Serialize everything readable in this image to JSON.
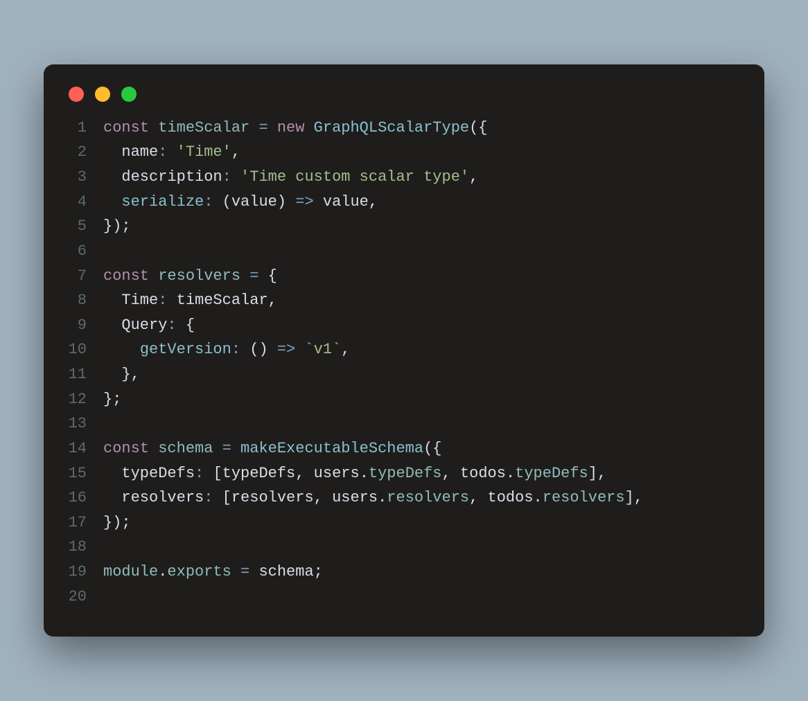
{
  "window": {
    "traffic_lights": [
      "red",
      "yellow",
      "green"
    ]
  },
  "colors": {
    "keyword": "#b48ead",
    "variable": "#8fbcbb",
    "operator": "#81a1c1",
    "call": "#88c0d0",
    "punctuation": "#d8dee9",
    "string": "#a3be8c",
    "gutter": "#5c6b6f",
    "background": "#1f1d1c",
    "page_background": "#a1b2bf"
  },
  "code": {
    "lines": [
      {
        "n": 1,
        "tokens": [
          {
            "cls": "kw",
            "t": "const"
          },
          {
            "cls": "ws",
            "t": " "
          },
          {
            "cls": "var",
            "t": "timeScalar"
          },
          {
            "cls": "ws",
            "t": " "
          },
          {
            "cls": "op",
            "t": "="
          },
          {
            "cls": "ws",
            "t": " "
          },
          {
            "cls": "kw",
            "t": "new"
          },
          {
            "cls": "ws",
            "t": " "
          },
          {
            "cls": "call",
            "t": "GraphQLScalarType"
          },
          {
            "cls": "pun",
            "t": "({"
          }
        ]
      },
      {
        "n": 2,
        "tokens": [
          {
            "cls": "ws",
            "t": "  "
          },
          {
            "cls": "prop",
            "t": "name"
          },
          {
            "cls": "op",
            "t": ":"
          },
          {
            "cls": "ws",
            "t": " "
          },
          {
            "cls": "str",
            "t": "'Time'"
          },
          {
            "cls": "pun",
            "t": ","
          }
        ]
      },
      {
        "n": 3,
        "tokens": [
          {
            "cls": "ws",
            "t": "  "
          },
          {
            "cls": "prop",
            "t": "description"
          },
          {
            "cls": "op",
            "t": ":"
          },
          {
            "cls": "ws",
            "t": " "
          },
          {
            "cls": "str",
            "t": "'Time custom scalar type'"
          },
          {
            "cls": "pun",
            "t": ","
          }
        ]
      },
      {
        "n": 4,
        "tokens": [
          {
            "cls": "ws",
            "t": "  "
          },
          {
            "cls": "call",
            "t": "serialize"
          },
          {
            "cls": "op",
            "t": ":"
          },
          {
            "cls": "ws",
            "t": " "
          },
          {
            "cls": "pun",
            "t": "("
          },
          {
            "cls": "param",
            "t": "value"
          },
          {
            "cls": "pun",
            "t": ")"
          },
          {
            "cls": "ws",
            "t": " "
          },
          {
            "cls": "op",
            "t": "=>"
          },
          {
            "cls": "ws",
            "t": " "
          },
          {
            "cls": "prop",
            "t": "value"
          },
          {
            "cls": "pun",
            "t": ","
          }
        ]
      },
      {
        "n": 5,
        "tokens": [
          {
            "cls": "pun",
            "t": "});"
          }
        ]
      },
      {
        "n": 6,
        "tokens": []
      },
      {
        "n": 7,
        "tokens": [
          {
            "cls": "kw",
            "t": "const"
          },
          {
            "cls": "ws",
            "t": " "
          },
          {
            "cls": "var",
            "t": "resolvers"
          },
          {
            "cls": "ws",
            "t": " "
          },
          {
            "cls": "op",
            "t": "="
          },
          {
            "cls": "ws",
            "t": " "
          },
          {
            "cls": "pun",
            "t": "{"
          }
        ]
      },
      {
        "n": 8,
        "tokens": [
          {
            "cls": "ws",
            "t": "  "
          },
          {
            "cls": "prop",
            "t": "Time"
          },
          {
            "cls": "op",
            "t": ":"
          },
          {
            "cls": "ws",
            "t": " "
          },
          {
            "cls": "prop",
            "t": "timeScalar"
          },
          {
            "cls": "pun",
            "t": ","
          }
        ]
      },
      {
        "n": 9,
        "tokens": [
          {
            "cls": "ws",
            "t": "  "
          },
          {
            "cls": "prop",
            "t": "Query"
          },
          {
            "cls": "op",
            "t": ":"
          },
          {
            "cls": "ws",
            "t": " "
          },
          {
            "cls": "pun",
            "t": "{"
          }
        ]
      },
      {
        "n": 10,
        "tokens": [
          {
            "cls": "ws",
            "t": "    "
          },
          {
            "cls": "call",
            "t": "getVersion"
          },
          {
            "cls": "op",
            "t": ":"
          },
          {
            "cls": "ws",
            "t": " "
          },
          {
            "cls": "pun",
            "t": "()"
          },
          {
            "cls": "ws",
            "t": " "
          },
          {
            "cls": "op",
            "t": "=>"
          },
          {
            "cls": "ws",
            "t": " "
          },
          {
            "cls": "tpl",
            "t": "`v1`"
          },
          {
            "cls": "pun",
            "t": ","
          }
        ]
      },
      {
        "n": 11,
        "tokens": [
          {
            "cls": "ws",
            "t": "  "
          },
          {
            "cls": "pun",
            "t": "},"
          }
        ]
      },
      {
        "n": 12,
        "tokens": [
          {
            "cls": "pun",
            "t": "};"
          }
        ]
      },
      {
        "n": 13,
        "tokens": []
      },
      {
        "n": 14,
        "tokens": [
          {
            "cls": "kw",
            "t": "const"
          },
          {
            "cls": "ws",
            "t": " "
          },
          {
            "cls": "var",
            "t": "schema"
          },
          {
            "cls": "ws",
            "t": " "
          },
          {
            "cls": "op",
            "t": "="
          },
          {
            "cls": "ws",
            "t": " "
          },
          {
            "cls": "call",
            "t": "makeExecutableSchema"
          },
          {
            "cls": "pun",
            "t": "({"
          }
        ]
      },
      {
        "n": 15,
        "tokens": [
          {
            "cls": "ws",
            "t": "  "
          },
          {
            "cls": "prop",
            "t": "typeDefs"
          },
          {
            "cls": "op",
            "t": ":"
          },
          {
            "cls": "ws",
            "t": " "
          },
          {
            "cls": "pun",
            "t": "["
          },
          {
            "cls": "prop",
            "t": "typeDefs"
          },
          {
            "cls": "pun",
            "t": ", "
          },
          {
            "cls": "prop",
            "t": "users"
          },
          {
            "cls": "pun",
            "t": "."
          },
          {
            "cls": "var",
            "t": "typeDefs"
          },
          {
            "cls": "pun",
            "t": ", "
          },
          {
            "cls": "prop",
            "t": "todos"
          },
          {
            "cls": "pun",
            "t": "."
          },
          {
            "cls": "var",
            "t": "typeDefs"
          },
          {
            "cls": "pun",
            "t": "],"
          }
        ]
      },
      {
        "n": 16,
        "tokens": [
          {
            "cls": "ws",
            "t": "  "
          },
          {
            "cls": "prop",
            "t": "resolvers"
          },
          {
            "cls": "op",
            "t": ":"
          },
          {
            "cls": "ws",
            "t": " "
          },
          {
            "cls": "pun",
            "t": "["
          },
          {
            "cls": "prop",
            "t": "resolvers"
          },
          {
            "cls": "pun",
            "t": ", "
          },
          {
            "cls": "prop",
            "t": "users"
          },
          {
            "cls": "pun",
            "t": "."
          },
          {
            "cls": "var",
            "t": "resolvers"
          },
          {
            "cls": "pun",
            "t": ", "
          },
          {
            "cls": "prop",
            "t": "todos"
          },
          {
            "cls": "pun",
            "t": "."
          },
          {
            "cls": "var",
            "t": "resolvers"
          },
          {
            "cls": "pun",
            "t": "],"
          }
        ]
      },
      {
        "n": 17,
        "tokens": [
          {
            "cls": "pun",
            "t": "});"
          }
        ]
      },
      {
        "n": 18,
        "tokens": []
      },
      {
        "n": 19,
        "tokens": [
          {
            "cls": "var",
            "t": "module"
          },
          {
            "cls": "pun",
            "t": "."
          },
          {
            "cls": "var",
            "t": "exports"
          },
          {
            "cls": "ws",
            "t": " "
          },
          {
            "cls": "op",
            "t": "="
          },
          {
            "cls": "ws",
            "t": " "
          },
          {
            "cls": "prop",
            "t": "schema"
          },
          {
            "cls": "pun",
            "t": ";"
          }
        ]
      },
      {
        "n": 20,
        "tokens": []
      }
    ]
  }
}
